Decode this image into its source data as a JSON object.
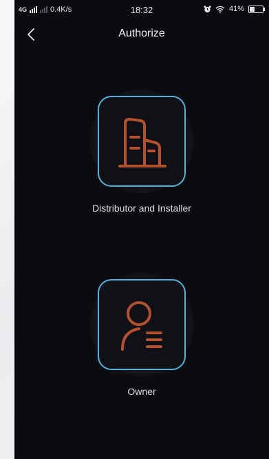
{
  "status_bar": {
    "network": "4G",
    "speed": "0.4K/s",
    "time": "18:32",
    "battery": "41%",
    "battery_level": 0.41
  },
  "nav": {
    "title": "Authorize"
  },
  "roles": [
    {
      "label": "Distributor and Installer",
      "icon": "building-icon"
    },
    {
      "label": "Owner",
      "icon": "user-list-icon"
    }
  ],
  "colors": {
    "accent_border": "#4fb3dc",
    "icon_color": "#b3512d",
    "background": "#0b0c10"
  }
}
